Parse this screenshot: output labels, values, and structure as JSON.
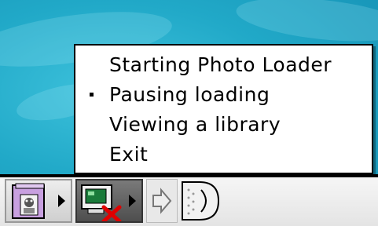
{
  "menu": {
    "items": [
      {
        "label": "Starting Photo Loader",
        "checked": false
      },
      {
        "label": "Pausing loading",
        "checked": true
      },
      {
        "label": "Viewing a library",
        "checked": false
      },
      {
        "label": "Exit",
        "checked": false
      }
    ]
  },
  "control_strip": {
    "tiles": [
      {
        "icon": "photo-album-icon"
      },
      {
        "icon": "camera-disconnected-icon"
      },
      {
        "icon": "arrow-right-icon"
      },
      {
        "icon": "strip-end-tab-icon"
      }
    ]
  },
  "colors": {
    "desktop": "#21a9c8",
    "menu_bg": "#ffffff",
    "text": "#000000",
    "error_x": "#e00000"
  }
}
